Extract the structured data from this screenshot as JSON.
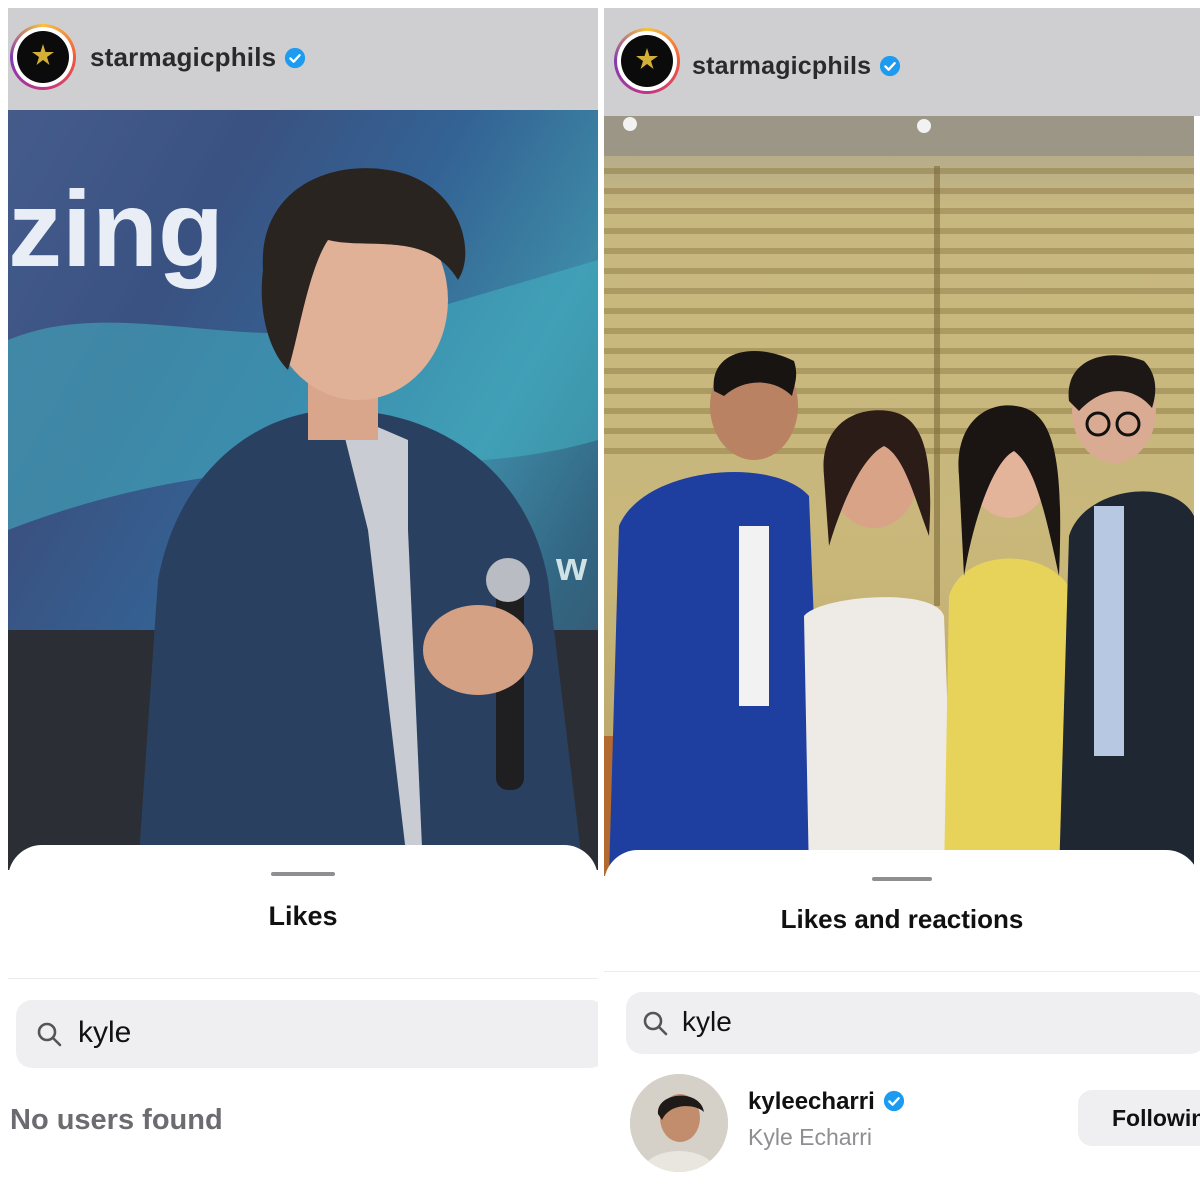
{
  "left_panel": {
    "header": {
      "username": "starmagicphils",
      "avatar_icon": "star-magic-logo-icon",
      "verified_icon": "verified-badge-icon"
    },
    "photo": {
      "backdrop_text": "zing",
      "backdrop_text_2": "w"
    },
    "likes_sheet": {
      "title": "Likes",
      "search": {
        "value": "kyle",
        "icon": "search-icon"
      },
      "empty_message": "No users found"
    }
  },
  "right_panel": {
    "header": {
      "username": "starmagicphils",
      "avatar_icon": "star-magic-logo-icon",
      "verified_icon": "verified-badge-icon"
    },
    "likes_sheet": {
      "title": "Likes and reactions",
      "search": {
        "value": "kyle",
        "icon": "search-icon"
      },
      "results": [
        {
          "handle": "kyleecharri",
          "name": "Kyle Echarri",
          "verified": true,
          "button": "Following"
        }
      ]
    }
  },
  "colors": {
    "verified_blue": "#1d9bf0",
    "sheet_bg": "#ffffff",
    "search_bg": "#efeff1",
    "header_bg": "#cfcfd1"
  }
}
